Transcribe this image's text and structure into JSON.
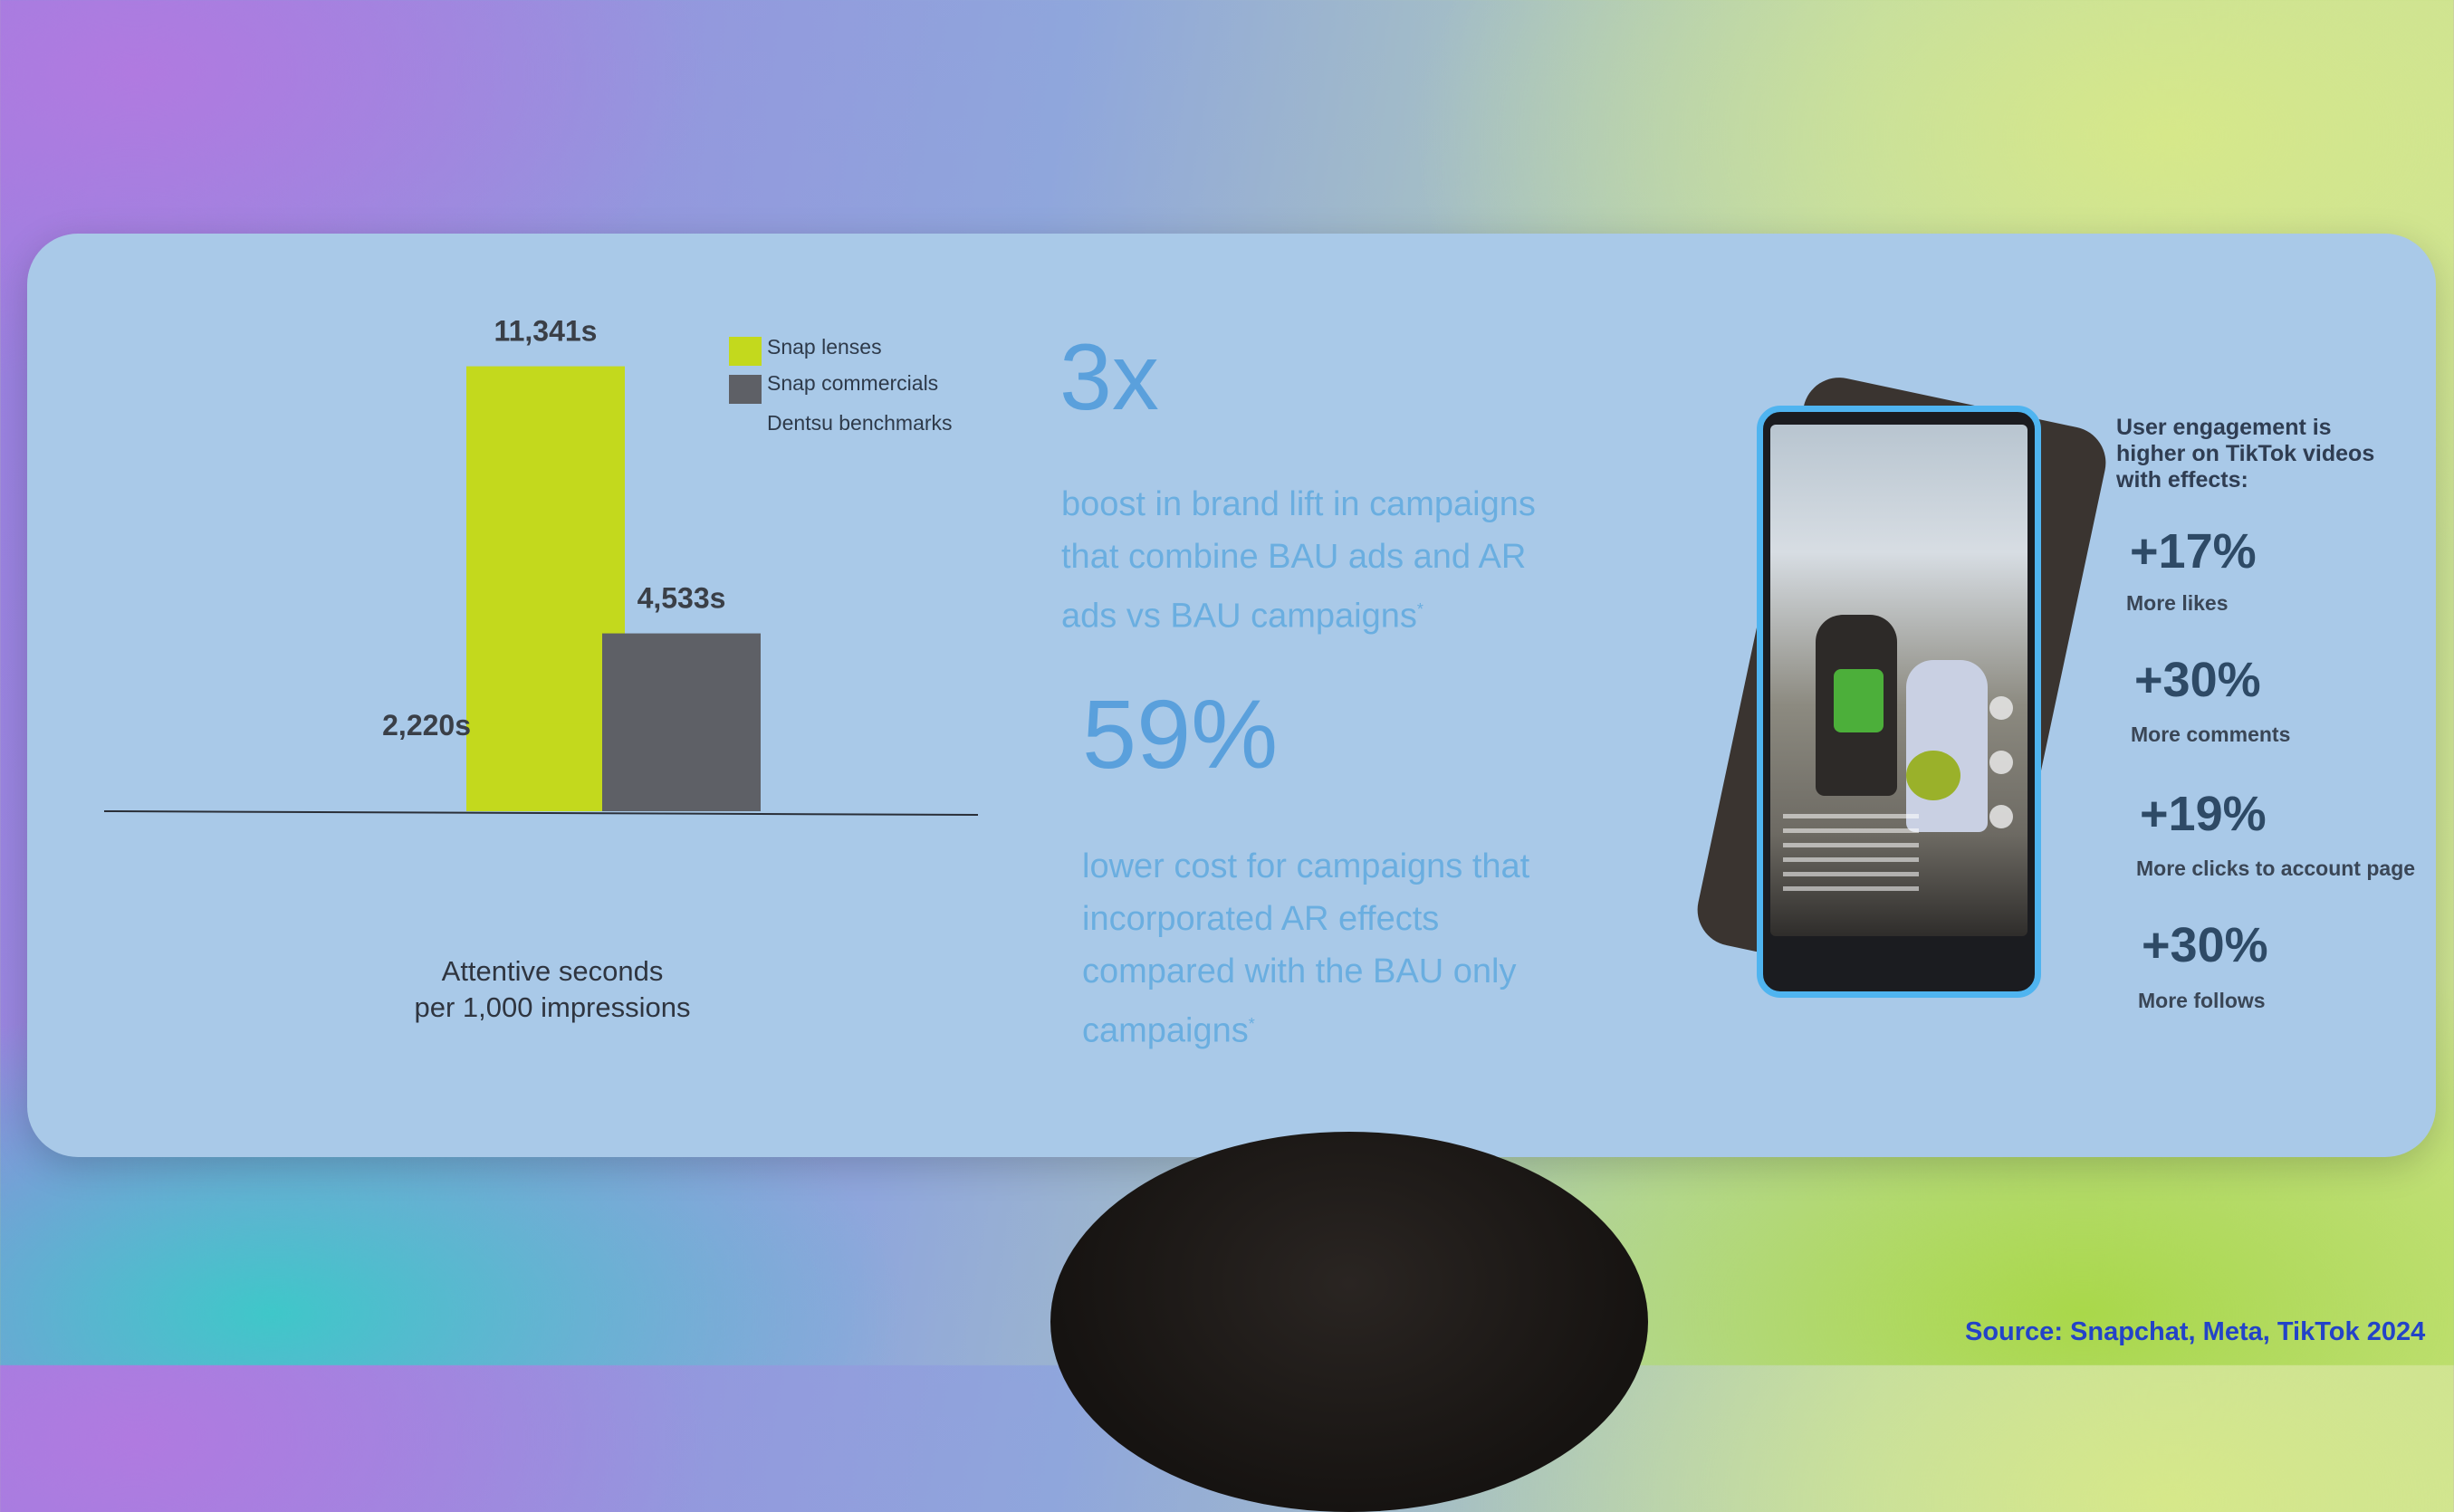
{
  "chart_data": {
    "type": "bar",
    "series": [
      {
        "name": "Snap lenses",
        "color": "#c3d91d",
        "label": "11,341s",
        "value": 11341
      },
      {
        "name": "Snap commercials",
        "color": "#5e6066",
        "label": "4,533s",
        "value": 4533
      },
      {
        "name": "Dentsu benchmarks",
        "color": "#c3d91d",
        "label": "2,220s",
        "value": 2220
      }
    ],
    "xlabel_line1": "Attentive seconds",
    "xlabel_line2": "per 1,000 impressions",
    "ylim": [
      0,
      12000
    ]
  },
  "stats": {
    "stat1_value": "3x",
    "stat1_text": [
      "boost in brand lift in campaigns",
      "that combine BAU ads and AR",
      "ads vs BAU campaigns"
    ],
    "stat2_value": "59%",
    "stat2_text": [
      "lower cost for campaigns that",
      "incorporated AR effects",
      "compared with the BAU only",
      "campaigns"
    ],
    "footnote_mark": "*"
  },
  "engagement": {
    "title": "User engagement is higher on TikTok videos with effects:",
    "items": [
      {
        "value": "+17%",
        "label": "More likes"
      },
      {
        "value": "+30%",
        "label": "More comments"
      },
      {
        "value": "+19%",
        "label": "More clicks to account page"
      },
      {
        "value": "+30%",
        "label": "More follows"
      }
    ]
  },
  "source": "Source: Snapchat, Meta, TikTok 2024"
}
